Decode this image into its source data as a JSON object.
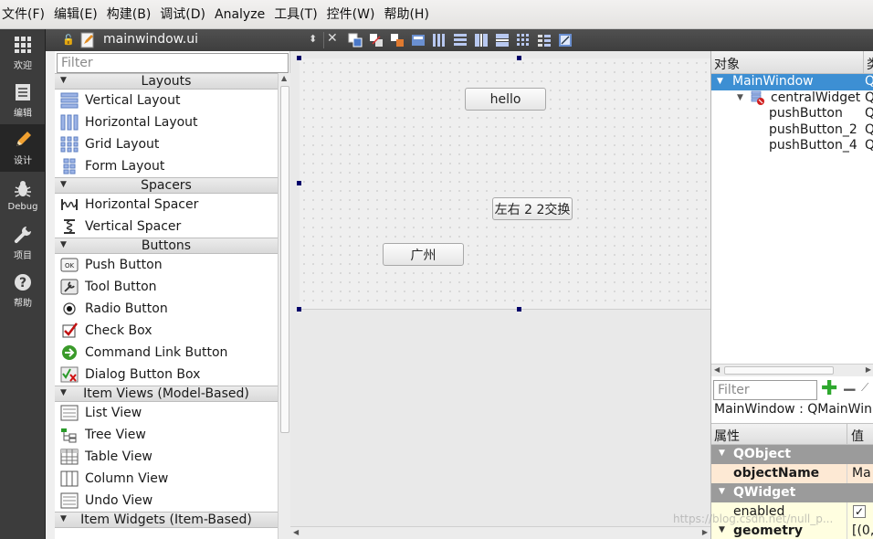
{
  "menu": [
    "文件(F)",
    "编辑(E)",
    "构建(B)",
    "调试(D)",
    "Analyze",
    "工具(T)",
    "控件(W)",
    "帮助(H)"
  ],
  "modes": [
    {
      "label": "欢迎",
      "icon": "grid-icon"
    },
    {
      "label": "编辑",
      "icon": "document-icon"
    },
    {
      "label": "设计",
      "icon": "pencil-icon"
    },
    {
      "label": "Debug",
      "icon": "bug-icon"
    },
    {
      "label": "项目",
      "icon": "wrench-icon"
    },
    {
      "label": "帮助",
      "icon": "help-icon"
    }
  ],
  "document_tab": {
    "title": "mainwindow.ui"
  },
  "widget_box": {
    "filter_placeholder": "Filter",
    "categories": [
      {
        "name": "Layouts",
        "items": [
          "Vertical Layout",
          "Horizontal Layout",
          "Grid Layout",
          "Form Layout"
        ]
      },
      {
        "name": "Spacers",
        "items": [
          "Horizontal Spacer",
          "Vertical Spacer"
        ]
      },
      {
        "name": "Buttons",
        "items": [
          "Push Button",
          "Tool Button",
          "Radio Button",
          "Check Box",
          "Command Link Button",
          "Dialog Button Box"
        ]
      },
      {
        "name": "Item Views (Model-Based)",
        "items": [
          "List View",
          "Tree View",
          "Table View",
          "Column View",
          "Undo View"
        ]
      },
      {
        "name": "Item Widgets (Item-Based)",
        "items": []
      }
    ]
  },
  "form": {
    "buttons": [
      {
        "label": "hello"
      },
      {
        "label": "左右 2 2交换"
      },
      {
        "label": "广州"
      }
    ]
  },
  "object_inspector": {
    "col_object": "对象",
    "col_class": "类",
    "rows": [
      {
        "name": "MainWindow",
        "class": "Q",
        "selected": true
      },
      {
        "name": "centralWidget",
        "class": "Q"
      },
      {
        "name": "pushButton",
        "class": "Q"
      },
      {
        "name": "pushButton_2",
        "class": "Q"
      },
      {
        "name": "pushButton_4",
        "class": "Q"
      }
    ]
  },
  "property_editor": {
    "filter_placeholder": "Filter",
    "class_label": "MainWindow : QMainWin...",
    "col_property": "属性",
    "col_value": "值",
    "rows": [
      {
        "kind": "group",
        "name": "QObject"
      },
      {
        "kind": "obj",
        "name": "objectName",
        "value": "Ma"
      },
      {
        "kind": "group",
        "name": "QWidget"
      },
      {
        "kind": "widget",
        "name": "enabled",
        "value": "✓"
      },
      {
        "kind": "widget-bold",
        "name": "geometry",
        "value": "[(0,"
      }
    ]
  },
  "watermark": "https://blog.csdn.net/null_p..."
}
